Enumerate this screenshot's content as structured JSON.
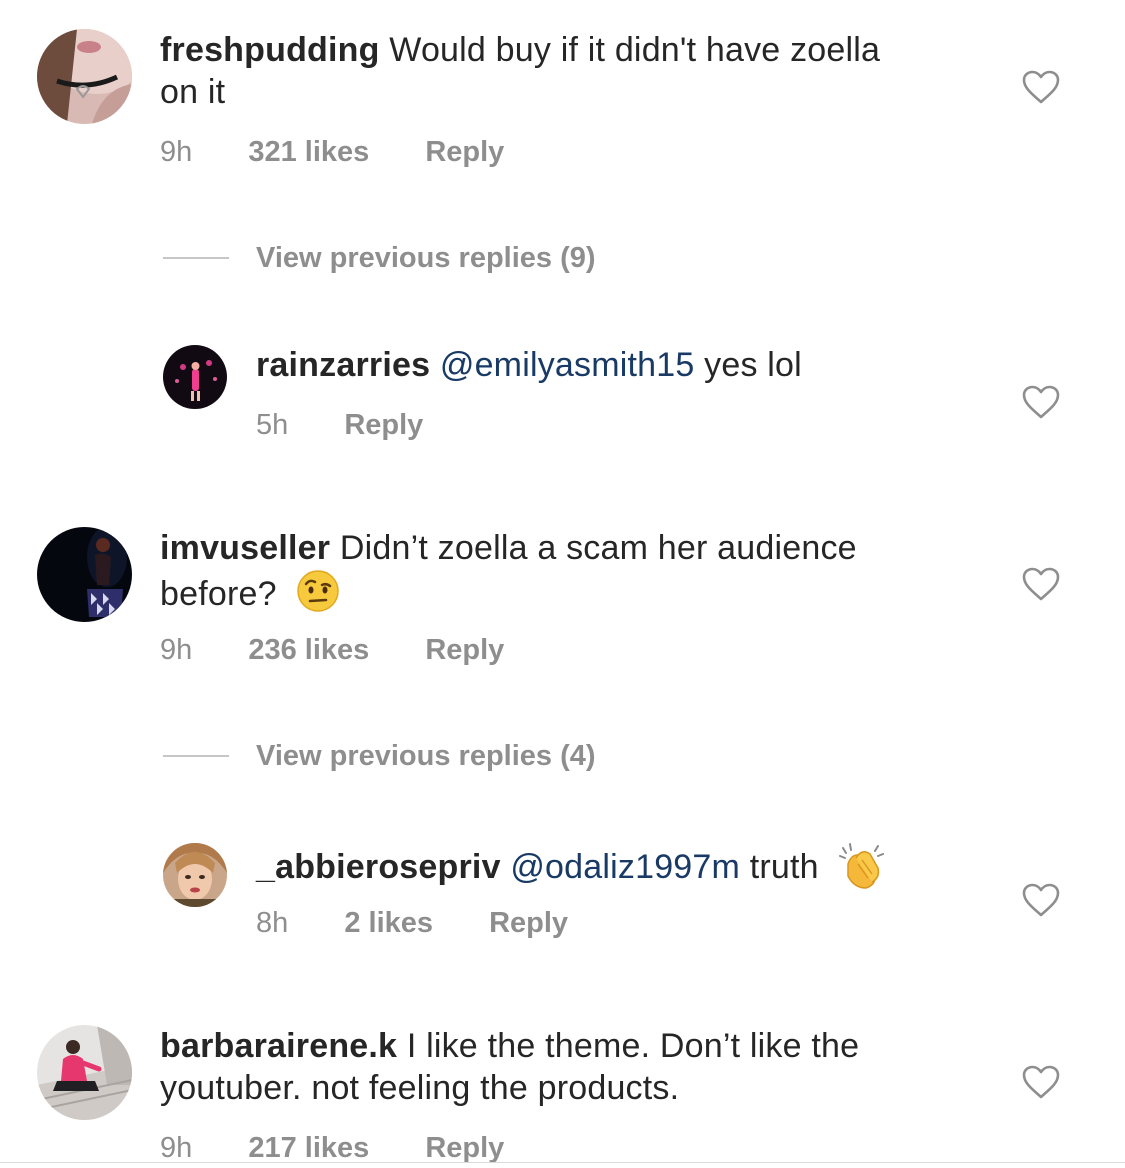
{
  "comments": [
    {
      "username": "freshpudding",
      "text_line1": "Would buy if it didn't have zoella",
      "text_line2": "on it",
      "time": "9h",
      "likes": "321 likes",
      "reply": "Reply"
    },
    {
      "username": "imvuseller",
      "text_line1": "Didn’t zoella a scam her audience",
      "text_line2": "before?",
      "emoji": "face-with-raised-eyebrow",
      "time": "9h",
      "likes": "236 likes",
      "reply": "Reply"
    },
    {
      "username": "barbarairene.k",
      "text_line1": "I like the theme. Don’t like the",
      "text_line2": "youtuber. not feeling the products.",
      "time": "9h",
      "likes": "217 likes",
      "reply": "Reply"
    }
  ],
  "replies": [
    {
      "username": "rainzarries",
      "mention": "@emilyasmith15",
      "text": "yes lol",
      "time": "5h",
      "reply": "Reply"
    },
    {
      "username": "_abbierosepriv",
      "mention": "@odaliz1997m",
      "text": "truth",
      "emoji": "clapping-hands",
      "time": "8h",
      "likes": "2 likes",
      "reply": "Reply"
    }
  ],
  "view_replies": [
    {
      "label": "View previous replies (9)"
    },
    {
      "label": "View previous replies (4)"
    }
  ],
  "icons": {
    "like": "heart-outline-icon"
  },
  "colors": {
    "text": "#262626",
    "meta": "#8e8e8e",
    "mention": "#1a3a66",
    "divider": "#c7c7c7"
  }
}
